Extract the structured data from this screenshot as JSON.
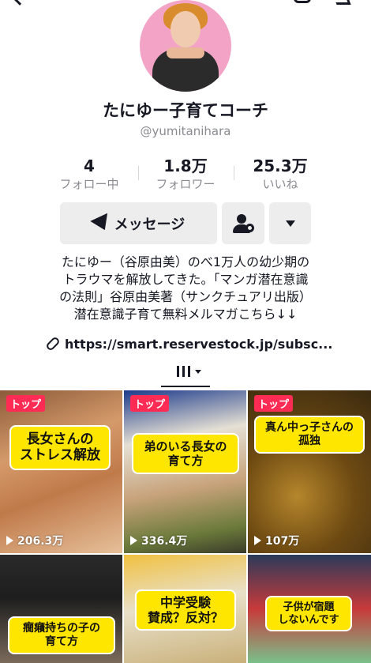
{
  "profile": {
    "name": "たにゆー子育てコーチ",
    "handle": "@yumitanihara"
  },
  "stats": [
    {
      "value": "4",
      "label": "フォロー中"
    },
    {
      "value": "1.8万",
      "label": "フォロワー"
    },
    {
      "value": "25.3万",
      "label": "いいね"
    }
  ],
  "actions": {
    "message_label": "メッセージ"
  },
  "bio": {
    "lines": [
      "たにゆー（谷原由美）のべ1万人の幼少期の",
      "トラウマを解放してきた。「マンガ潜在意識",
      "の法則」谷原由美著（サンクチュアリ出版）",
      "潜在意識子育て無料メルマガこちら↓↓"
    ],
    "link": "https://smart.reservestock.jp/subsc..."
  },
  "videos": [
    {
      "badge": "トップ",
      "caption": "長女さんの\nストレス解放",
      "views": "206.3万"
    },
    {
      "badge": "トップ",
      "caption": "弟のいる長女の\n育て方",
      "views": "336.4万"
    },
    {
      "badge": "トップ",
      "caption": "真ん中っ子さんの\n孤独",
      "views": "107万"
    },
    {
      "caption": "癇癪持ちの子の\n育て方"
    },
    {
      "caption": "中学受験\n賛成？反対？"
    },
    {
      "caption": "子供が宿題\nしないんです"
    }
  ],
  "colors": {
    "badge": "#fe2c55",
    "caption_bg": "#ffe600",
    "avatar_bg": "#f3a4c6"
  }
}
